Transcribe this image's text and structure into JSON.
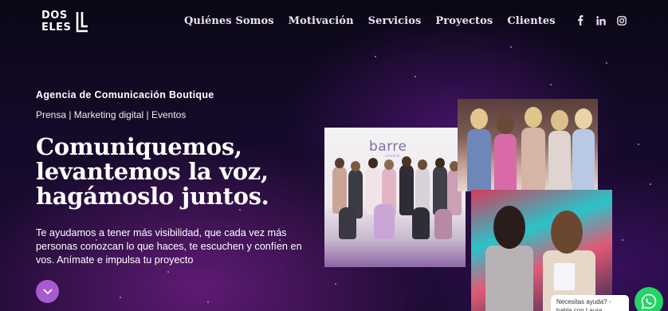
{
  "header": {
    "logo": {
      "line1": "DOS",
      "line2": "ELES"
    },
    "nav": [
      "Quiénes Somos",
      "Motivación",
      "Servicios",
      "Proyectos",
      "Clientes"
    ],
    "social": [
      "facebook-icon",
      "linkedin-icon",
      "instagram-icon"
    ]
  },
  "hero": {
    "tagline": "Agencia de Comunicación Boutique",
    "services": "Prensa | Marketing digital | Eventos",
    "headline_lines": [
      "Comuniquemos,",
      "levantemos la voz,",
      "hagámoslo juntos."
    ],
    "description": "Te ayudamos a tener más visibilidad, que cada vez más personas conozcan lo que haces, te escuchen y confíen en vos. Anímate e impulsa tu proyecto",
    "scroll_icon": "chevron-down-icon"
  },
  "photos": {
    "studio_brand": "barre",
    "studio_sub": "studio"
  },
  "whatsapp": {
    "bubble_text": "Necesitas ayuda? - habla con Laura",
    "icon": "whatsapp-icon"
  },
  "colors": {
    "accent_purple": "#a85ad0",
    "whatsapp_green": "#25d366",
    "background": "#150a2a"
  }
}
